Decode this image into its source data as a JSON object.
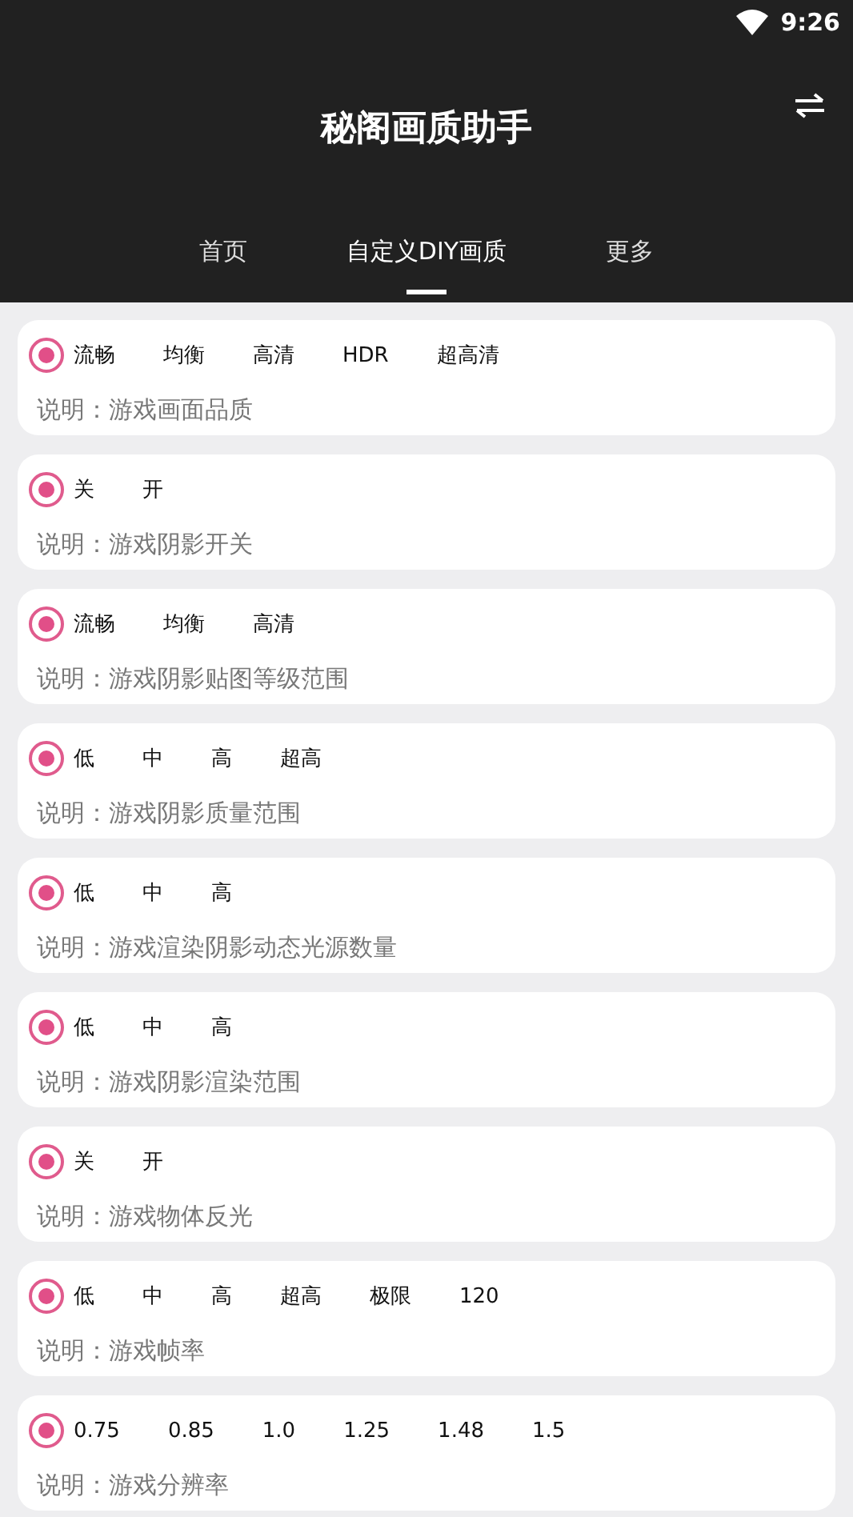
{
  "status_bar": {
    "time": "9:26"
  },
  "app_bar": {
    "title": "秘阁画质助手"
  },
  "tabs": [
    {
      "label": "首页",
      "selected": false
    },
    {
      "label": "自定义DIY画质",
      "selected": true
    },
    {
      "label": "更多",
      "selected": false
    }
  ],
  "settings": [
    {
      "options": [
        {
          "label": "流畅",
          "selected": true
        },
        {
          "label": "均衡",
          "selected": false
        },
        {
          "label": "高清",
          "selected": false
        },
        {
          "label": "HDR",
          "selected": false
        },
        {
          "label": "超高清",
          "selected": false
        }
      ],
      "description": "说明：游戏画面品质"
    },
    {
      "options": [
        {
          "label": "关",
          "selected": true
        },
        {
          "label": "开",
          "selected": false
        }
      ],
      "description": "说明：游戏阴影开关"
    },
    {
      "options": [
        {
          "label": "流畅",
          "selected": true
        },
        {
          "label": "均衡",
          "selected": false
        },
        {
          "label": "高清",
          "selected": false
        }
      ],
      "description": "说明：游戏阴影贴图等级范围"
    },
    {
      "options": [
        {
          "label": "低",
          "selected": true
        },
        {
          "label": "中",
          "selected": false
        },
        {
          "label": "高",
          "selected": false
        },
        {
          "label": "超高",
          "selected": false
        }
      ],
      "description": "说明：游戏阴影质量范围"
    },
    {
      "options": [
        {
          "label": "低",
          "selected": true
        },
        {
          "label": "中",
          "selected": false
        },
        {
          "label": "高",
          "selected": false
        }
      ],
      "description": "说明：游戏渲染阴影动态光源数量"
    },
    {
      "options": [
        {
          "label": "低",
          "selected": true
        },
        {
          "label": "中",
          "selected": false
        },
        {
          "label": "高",
          "selected": false
        }
      ],
      "description": "说明：游戏阴影渲染范围"
    },
    {
      "options": [
        {
          "label": "关",
          "selected": true
        },
        {
          "label": "开",
          "selected": false
        }
      ],
      "description": "说明：游戏物体反光"
    },
    {
      "options": [
        {
          "label": "低",
          "selected": true
        },
        {
          "label": "中",
          "selected": false
        },
        {
          "label": "高",
          "selected": false
        },
        {
          "label": "超高",
          "selected": false
        },
        {
          "label": "极限",
          "selected": false
        },
        {
          "label": "120",
          "selected": false
        }
      ],
      "description": "说明：游戏帧率"
    },
    {
      "options": [
        {
          "label": "0.75",
          "selected": true
        },
        {
          "label": "0.85",
          "selected": false
        },
        {
          "label": "1.0",
          "selected": false
        },
        {
          "label": "1.25",
          "selected": false
        },
        {
          "label": "1.48",
          "selected": false
        },
        {
          "label": "1.5",
          "selected": false
        }
      ],
      "description": "说明：游戏分辨率"
    }
  ]
}
